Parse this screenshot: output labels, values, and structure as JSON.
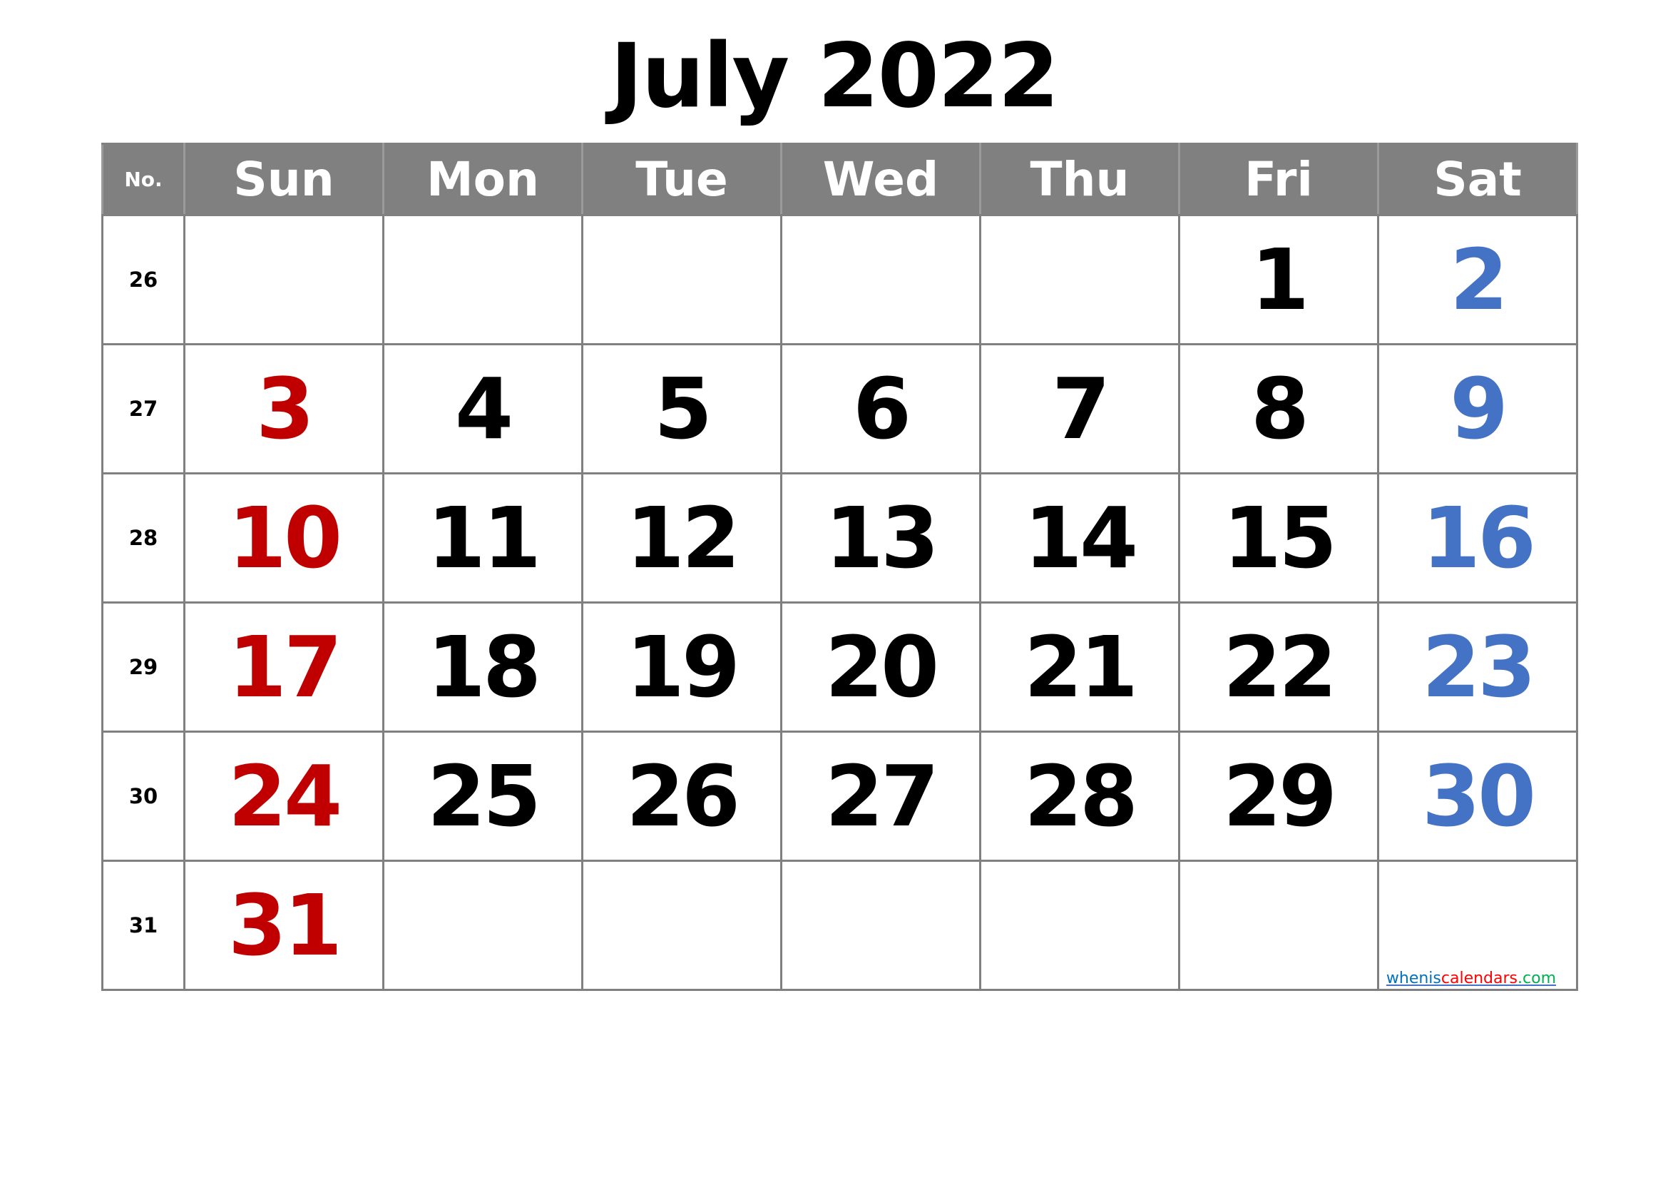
{
  "title": "July 2022",
  "header": {
    "week_no_label": "No.",
    "days": [
      "Sun",
      "Mon",
      "Tue",
      "Wed",
      "Thu",
      "Fri",
      "Sat"
    ]
  },
  "weeks": [
    {
      "no": "26",
      "days": [
        "",
        "",
        "",
        "",
        "",
        "1",
        "2"
      ]
    },
    {
      "no": "27",
      "days": [
        "3",
        "4",
        "5",
        "6",
        "7",
        "8",
        "9"
      ]
    },
    {
      "no": "28",
      "days": [
        "10",
        "11",
        "12",
        "13",
        "14",
        "15",
        "16"
      ]
    },
    {
      "no": "29",
      "days": [
        "17",
        "18",
        "19",
        "20",
        "21",
        "22",
        "23"
      ]
    },
    {
      "no": "30",
      "days": [
        "24",
        "25",
        "26",
        "27",
        "28",
        "29",
        "30"
      ]
    },
    {
      "no": "31",
      "days": [
        "31",
        "",
        "",
        "",
        "",
        "",
        ""
      ]
    }
  ],
  "watermark": {
    "part1": "whenis",
    "part2": "calendars",
    "part3": ".com"
  },
  "colors": {
    "header_bg": "#808080",
    "sunday": "#C00000",
    "saturday": "#4472C4",
    "weekday": "#000000",
    "wm1": "#0070C0",
    "wm2": "#FF0000",
    "wm3": "#00B050"
  }
}
